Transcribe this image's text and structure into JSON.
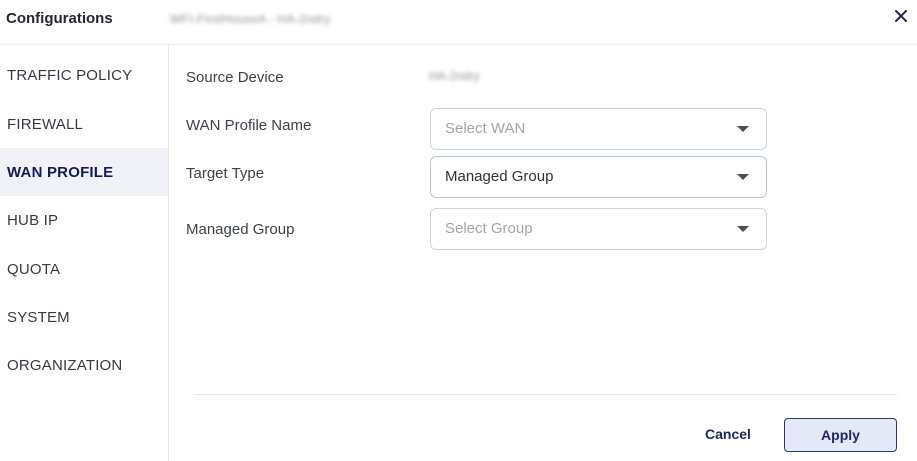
{
  "header": {
    "title": "Configurations",
    "subtitle": "WFI-FirstHouseA - HA-2ndry",
    "close_icon": "close-icon"
  },
  "sidebar": {
    "items": [
      {
        "label": "TRAFFIC POLICY",
        "active": false
      },
      {
        "label": "FIREWALL",
        "active": false
      },
      {
        "label": "WAN PROFILE",
        "active": true
      },
      {
        "label": "HUB IP",
        "active": false
      },
      {
        "label": "QUOTA",
        "active": false
      },
      {
        "label": "SYSTEM",
        "active": false
      },
      {
        "label": "ORGANIZATION",
        "active": false
      }
    ]
  },
  "form": {
    "source_device": {
      "label": "Source Device",
      "value": "HA-2ndry"
    },
    "wan_profile_name": {
      "label": "WAN Profile Name",
      "placeholder": "Select WAN",
      "value": ""
    },
    "target_type": {
      "label": "Target Type",
      "value": "Managed Group"
    },
    "managed_group": {
      "label": "Managed Group",
      "placeholder": "Select Group",
      "value": ""
    }
  },
  "footer": {
    "cancel_label": "Cancel",
    "apply_label": "Apply"
  },
  "colors": {
    "active_nav_bg": "#f1f2f7",
    "active_nav_text": "#151c52",
    "apply_bg": "#e5e8f6",
    "apply_border": "#2a3579",
    "select_border": "#c9d4e4"
  }
}
